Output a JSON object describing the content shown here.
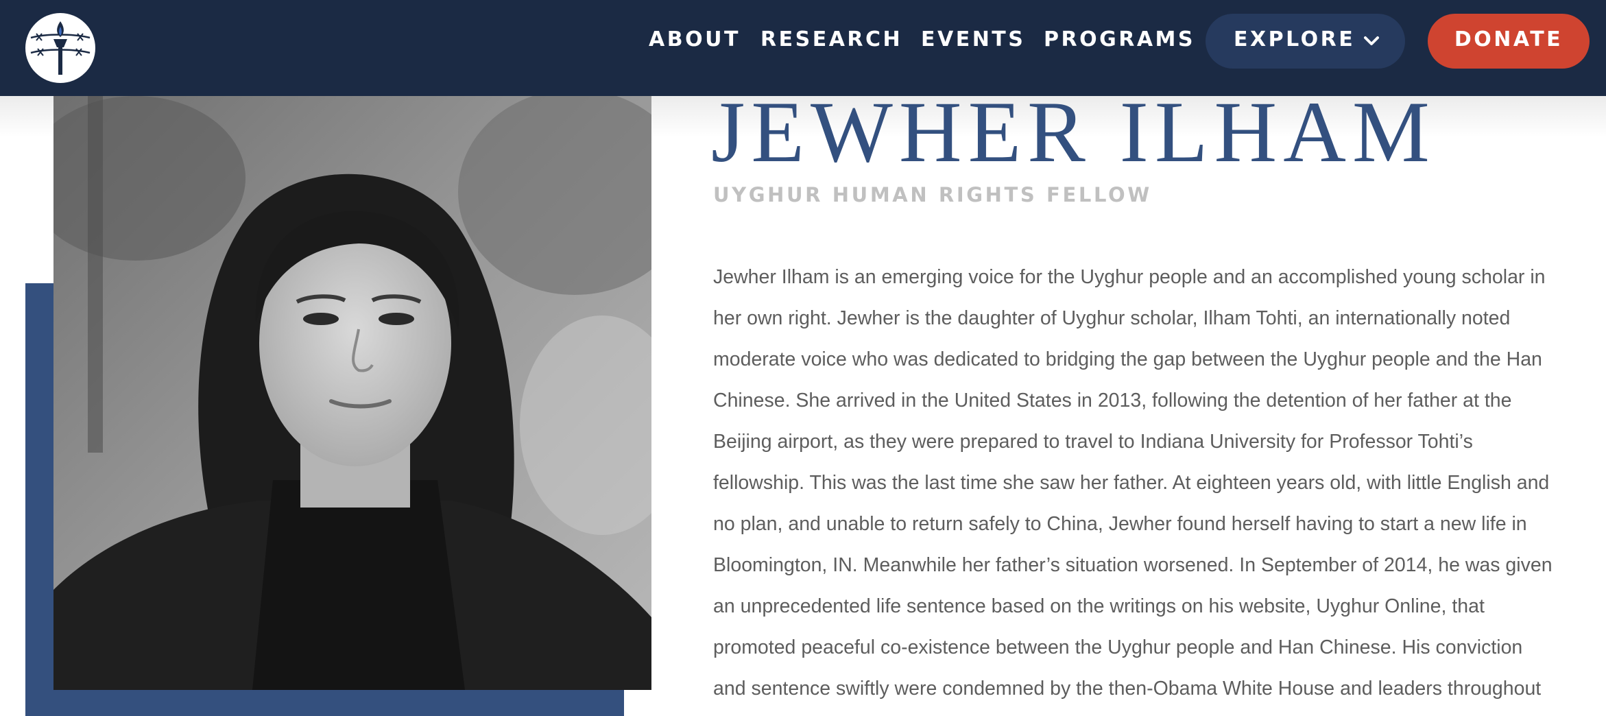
{
  "nav": {
    "links": [
      {
        "label": "ABOUT"
      },
      {
        "label": "RESEARCH"
      },
      {
        "label": "EVENTS"
      },
      {
        "label": "PROGRAMS"
      }
    ],
    "explore_label": "EXPLORE",
    "donate_label": "DONATE"
  },
  "profile": {
    "name": "JEWHER ILHAM",
    "role": "UYGHUR HUMAN RIGHTS FELLOW",
    "bio_lines": [
      "Jewher Ilham is an emerging voice for the Uyghur people and an accomplished young scholar in",
      "her own right. Jewher is the daughter of Uyghur scholar, Ilham Tohti, an internationally noted",
      "moderate voice who was dedicated to bridging the gap between the Uyghur people and the Han",
      "Chinese. She arrived in the United States in 2013, following the detention of her father at the",
      "Beijing airport, as they were prepared to travel to Indiana University for Professor Tohti’s",
      "fellowship. This was the last time she saw her father. At eighteen years old, with little English and",
      "no plan, and unable to return safely to China, Jewher found herself having to start a new life in",
      "Bloomington, IN. Meanwhile her father’s situation worsened. In September of 2014, he was given",
      "an unprecedented life sentence based on the writings on his website, Uyghur Online, that",
      "promoted peaceful co-existence between the Uyghur people and Han Chinese. His conviction",
      "and sentence swiftly were condemned by the then-Obama White House and leaders throughout"
    ]
  },
  "colors": {
    "header_bg": "#1b2a44",
    "explore_bg": "#263a5e",
    "donate_bg": "#cf4430",
    "accent_blue": "#34507e",
    "title_blue": "#33507f"
  },
  "icons": {
    "logo": "torch-barbed-wire-logo",
    "explore_chevron": "chevron-down-icon"
  }
}
